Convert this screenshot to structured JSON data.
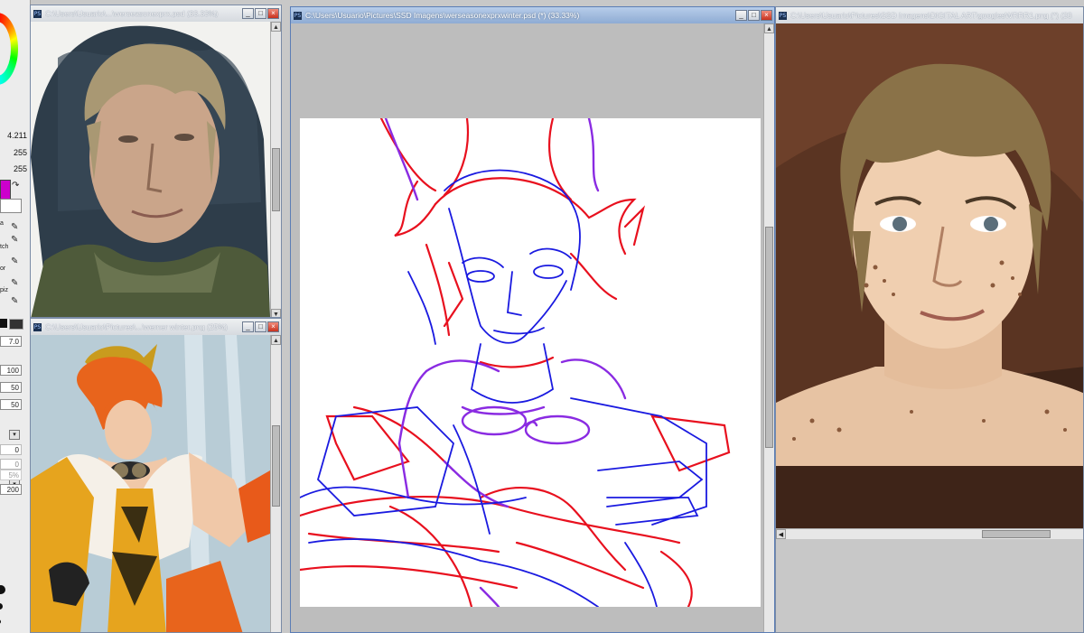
{
  "tool_panel": {
    "values": [
      "4.211",
      "255",
      "255"
    ],
    "tool_labels": [
      "a",
      "tch",
      "or",
      "piz"
    ],
    "fields": [
      "7.0",
      "100",
      "50",
      "50",
      "0",
      "0",
      "0",
      "5%",
      "200"
    ],
    "colors": {
      "foreground": "#cc00cc",
      "background": "#ffffff"
    }
  },
  "windows": {
    "reference_photo": {
      "title": "C:\\Users\\Usuario\\...\\werseasonexprx.psd (33.33%)"
    },
    "reference_art": {
      "title": "C:\\Users\\Usuario\\Pictures\\...\\werner winter.png (25%)"
    },
    "sketch_canvas": {
      "title": "C:\\Users\\Usuario\\Pictures\\SSD Imagens\\werseasonexprxwinter.psd (*) (33.33%)"
    },
    "painting": {
      "title": "C:\\Users\\Usuario\\Pictures\\SSD Imagens\\DIGITAL ART\\googlesWRRR1.png (*) (33"
    }
  },
  "window_buttons": {
    "minimize": "_",
    "maximize": "□",
    "close": "×"
  },
  "icons": {
    "app": "PS"
  }
}
